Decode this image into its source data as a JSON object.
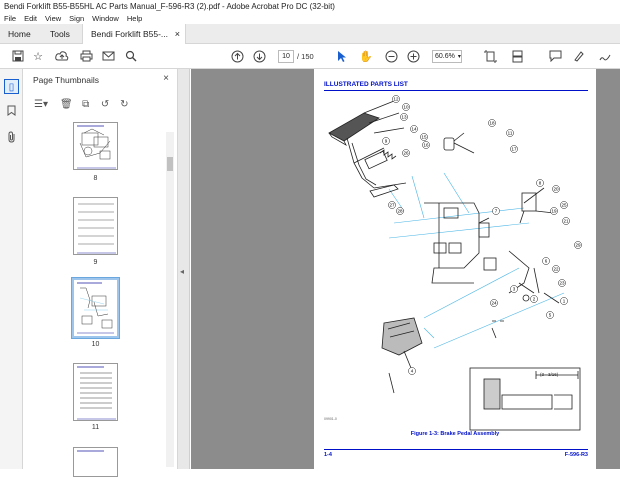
{
  "window": {
    "title": "Bendi Forklift B55-B55HL AC Parts Manual_F-596-R3 (2).pdf - Adobe Acrobat Pro DC (32-bit)"
  },
  "menu": {
    "items": [
      "File",
      "Edit",
      "View",
      "Sign",
      "Window",
      "Help"
    ]
  },
  "tabs": {
    "home": "Home",
    "tools": "Tools",
    "doc": "Bendi Forklift B55-...",
    "doc_close": "×"
  },
  "toolbar": {
    "page_current": "10",
    "page_total": "/  150",
    "zoom": "60.6%"
  },
  "thumbnails": {
    "title": "Page Thumbnails",
    "close": "×",
    "pages": [
      {
        "number": "8"
      },
      {
        "number": "9"
      },
      {
        "number": "10",
        "selected": true
      },
      {
        "number": "11"
      }
    ]
  },
  "document": {
    "header": "ILLUSTRATED PARTS LIST",
    "caption": "Figure 1-3:  Brake Pedal Assembly",
    "page_left": "1-4",
    "page_right": "F-596-R3",
    "ref_code": "09901-0",
    "dimension": "(3 - 3/16)",
    "callouts": [
      "12",
      "10",
      "13",
      "9",
      "14",
      "15",
      "16",
      "18",
      "11",
      "17",
      "7",
      "8",
      "20",
      "19",
      "25",
      "21",
      "22",
      "23",
      "26",
      "27",
      "28",
      "3",
      "2",
      "1",
      "6",
      "5",
      "4",
      "24",
      "29"
    ]
  },
  "colors": {
    "accent": "#0010c8",
    "leader": "#4bb6e6",
    "toolbar_bg": "#ececec",
    "viewer_bg": "#8c8c8c"
  }
}
